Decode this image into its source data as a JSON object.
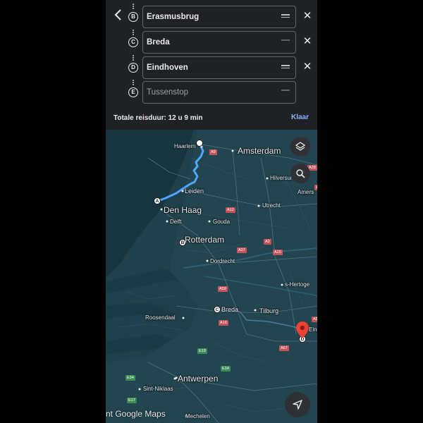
{
  "header": {
    "back_icon": "arrow-left-icon",
    "stops": [
      {
        "letter": "B",
        "value": "Erasmusbrug",
        "placeholder": false,
        "removable": true
      },
      {
        "letter": "C",
        "value": "Breda",
        "placeholder": false,
        "removable": true
      },
      {
        "letter": "D",
        "value": "Eindhoven",
        "placeholder": false,
        "removable": true
      },
      {
        "letter": "E",
        "value": "Tussenstop",
        "placeholder": true,
        "removable": false
      }
    ],
    "total_duration": "Totale reisduur: 12 u 9 min",
    "done_label": "Klaar"
  },
  "map": {
    "cities": {
      "haarlem": "Haarlem",
      "amsterdam": "Amsterdam",
      "hilversum": "Hilversum",
      "amersfoort": "Amers",
      "leiden": "Leiden",
      "den_haag": "Den Haag",
      "utrecht": "Utrecht",
      "delft": "Delft",
      "gouda": "Gouda",
      "rotterdam": "Rotterdam",
      "dordrecht": "Dordrecht",
      "s_hertogenbosch": "s-Hertoge",
      "breda": "Breda",
      "tilburg": "Tilburg",
      "roosendaal": "Roosendaal",
      "eindhoven": "Ein",
      "antwerpen": "Antwerpen",
      "sint_niklaas": "Sint-Niklaas",
      "mechelen": "Mechelen"
    },
    "roads": {
      "a9": "A9",
      "a12": "A12",
      "a27": "A27",
      "a2": "A2",
      "a15": "A15",
      "a59": "A59",
      "a16": "A16",
      "a58": "A58",
      "a67": "A67",
      "e19": "E19",
      "e34": "E34",
      "e17": "E17",
      "a28": "A28",
      "a1": "A1"
    },
    "waypoints": {
      "a": "A",
      "b": "B",
      "c": "C",
      "d": "D"
    },
    "attribution": "nt Google Maps",
    "route_color": "#4da6ff",
    "pin_color": "#ea4335"
  }
}
